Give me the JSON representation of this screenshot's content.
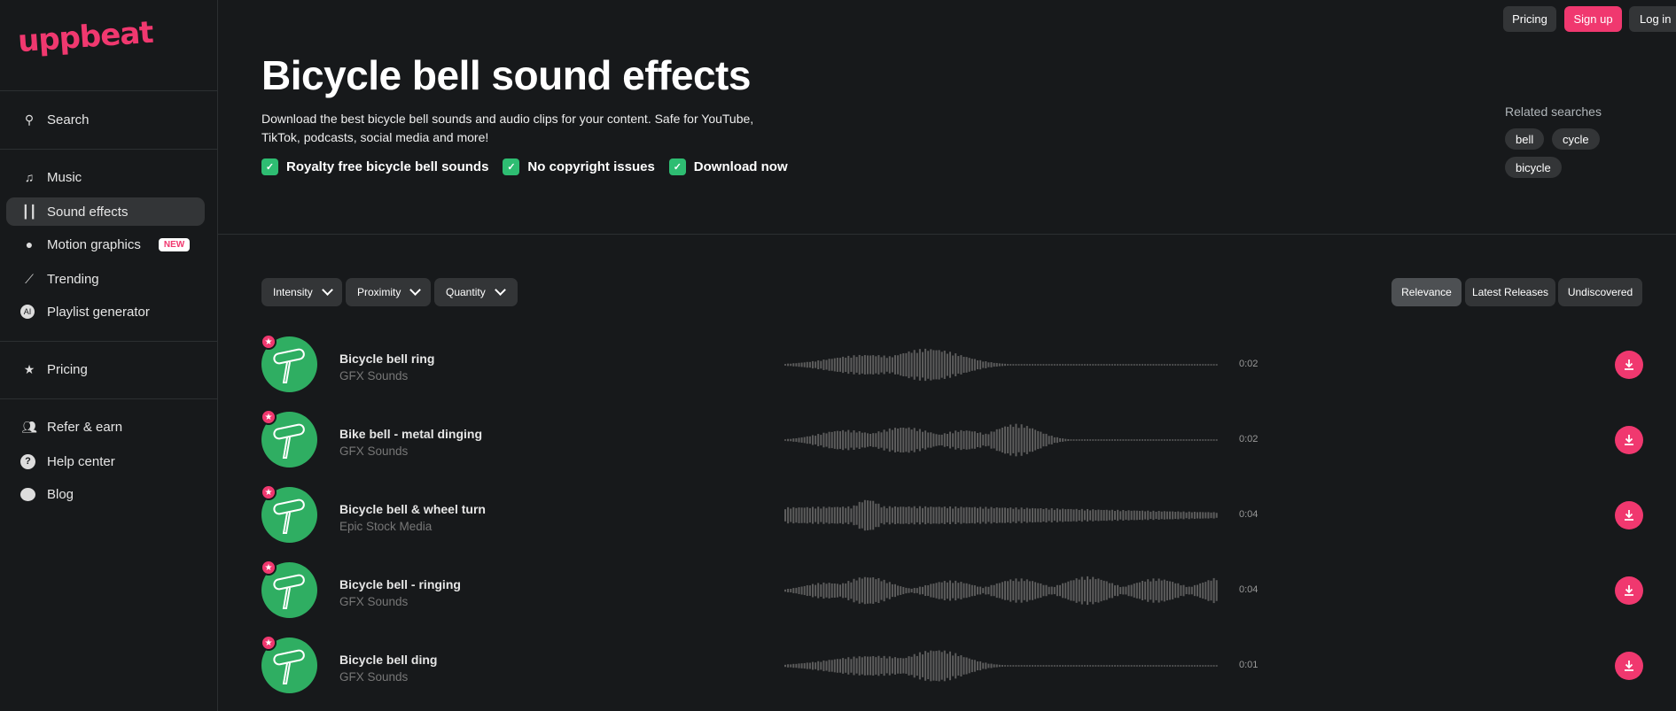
{
  "brand": {
    "logo": "uppbeat",
    "accent": "#f0386f",
    "green": "#2ebd72"
  },
  "sidebar": {
    "items": [
      {
        "label": "Search",
        "icon": "search-icon"
      },
      {
        "label": "Music",
        "icon": "music-note-icon"
      },
      {
        "label": "Sound effects",
        "icon": "waveform-icon",
        "active": true
      },
      {
        "label": "Motion graphics",
        "icon": "camera-icon",
        "badge": "NEW"
      },
      {
        "label": "Trending",
        "icon": "trending-icon"
      },
      {
        "label": "Playlist generator",
        "icon": "ai-icon"
      },
      {
        "label": "Pricing",
        "icon": "star-icon"
      },
      {
        "label": "Refer & earn",
        "icon": "users-icon"
      },
      {
        "label": "Help center",
        "icon": "help-icon"
      },
      {
        "label": "Blog",
        "icon": "chat-icon"
      }
    ]
  },
  "header": {
    "pricing": "Pricing",
    "signup": "Sign up",
    "login": "Log in"
  },
  "hero": {
    "title": "Bicycle bell sound effects",
    "description": "Download the best bicycle bell sounds and audio clips for your content. Safe for YouTube, TikTok, podcasts, social media and more!",
    "checks": [
      "Royalty free bicycle bell sounds",
      "No copyright issues",
      "Download now"
    ]
  },
  "related": {
    "title": "Related searches",
    "chips": [
      "bell",
      "cycle",
      "bicycle"
    ]
  },
  "filters": [
    "Intensity",
    "Proximity",
    "Quantity"
  ],
  "sort": {
    "options": [
      "Relevance",
      "Latest Releases",
      "Undiscovered"
    ],
    "selected": "Relevance"
  },
  "tracks": [
    {
      "title": "Bicycle bell ring",
      "artist": "GFX Sounds",
      "duration": "0:02"
    },
    {
      "title": "Bike bell - metal dinging",
      "artist": "GFX Sounds",
      "duration": "0:02"
    },
    {
      "title": "Bicycle bell & wheel turn",
      "artist": "Epic Stock Media",
      "duration": "0:04"
    },
    {
      "title": "Bicycle bell - ringing",
      "artist": "GFX Sounds",
      "duration": "0:04"
    },
    {
      "title": "Bicycle bell ding",
      "artist": "GFX Sounds",
      "duration": "0:01"
    }
  ]
}
